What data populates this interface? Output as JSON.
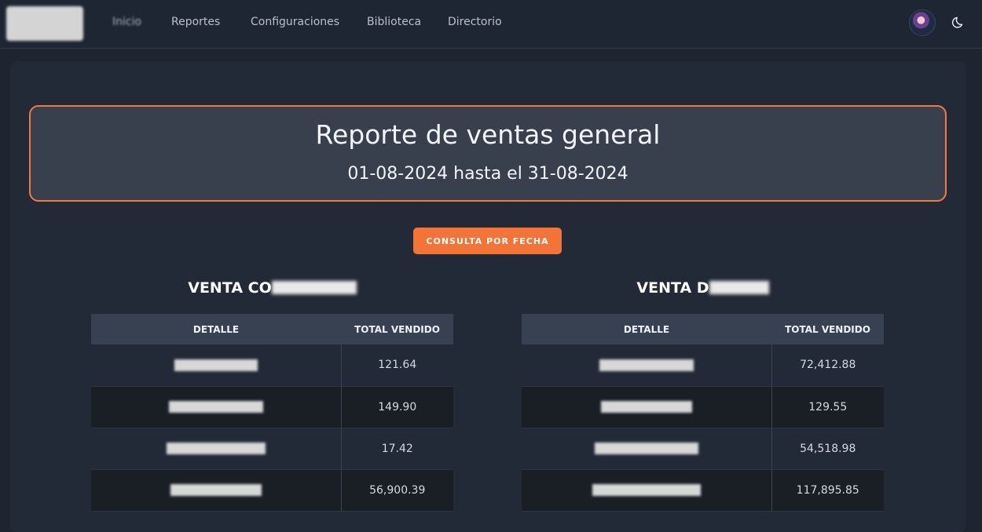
{
  "nav": {
    "items": [
      {
        "label": "Inicio"
      },
      {
        "label": "Reportes"
      },
      {
        "label": "Configuraciones"
      },
      {
        "label": "Biblioteca"
      },
      {
        "label": "Directorio"
      }
    ],
    "logo_icon": "redacted-logo",
    "avatar_icon": "user-avatar",
    "theme_icon": "moon-icon"
  },
  "report": {
    "title": "Reporte de ventas general",
    "range": "01-08-2024 hasta el 31-08-2024",
    "button_label": "CONSULTA POR FECHA"
  },
  "tables": [
    {
      "title_visible": "VENTA CO",
      "columns": [
        "DETALLE",
        "TOTAL VENDIDO"
      ],
      "rows": [
        {
          "detail": "",
          "total": "121.64"
        },
        {
          "detail": "",
          "total": "149.90"
        },
        {
          "detail": "",
          "total": "17.42"
        },
        {
          "detail": "",
          "total": "56,900.39"
        }
      ]
    },
    {
      "title_visible": "VENTA D",
      "columns": [
        "DETALLE",
        "TOTAL VENDIDO"
      ],
      "rows": [
        {
          "detail": "",
          "total": "72,412.88"
        },
        {
          "detail": "",
          "total": "129.55"
        },
        {
          "detail": "",
          "total": "54,518.98"
        },
        {
          "detail": "",
          "total": "117,895.85"
        }
      ]
    }
  ],
  "colors": {
    "accent": "#f37436",
    "background": "#1e2530",
    "panel": "#222a37",
    "header_box": "#38404e"
  }
}
